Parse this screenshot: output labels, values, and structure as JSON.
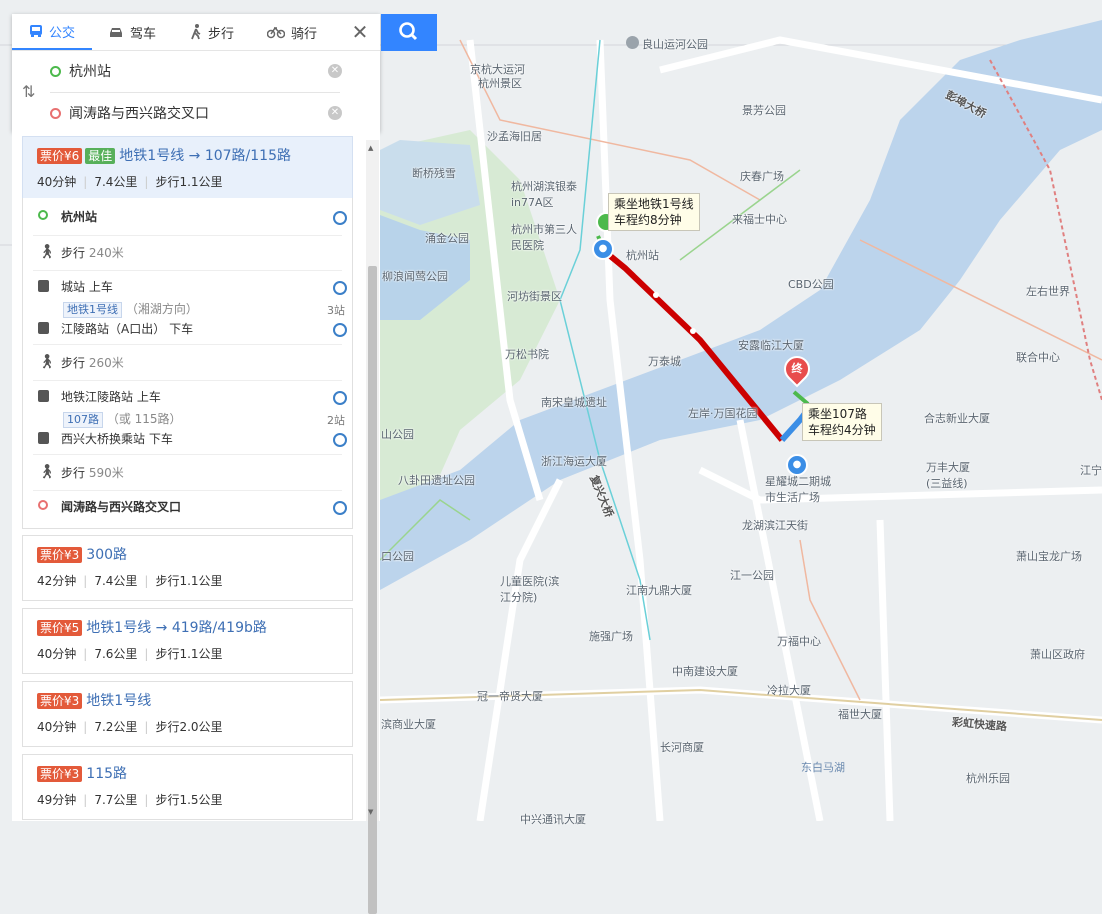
{
  "search": {
    "modes": [
      {
        "label": "公交",
        "icon": "bus-icon",
        "active": true
      },
      {
        "label": "驾车",
        "icon": "car-icon",
        "active": false
      },
      {
        "label": "步行",
        "icon": "walk-icon",
        "active": false
      },
      {
        "label": "骑行",
        "icon": "bike-icon",
        "active": false
      }
    ],
    "origin": "杭州站",
    "destination": "闻涛路与西兴路交叉口"
  },
  "routes": [
    {
      "price": "票价¥6",
      "best": "最佳",
      "name": "地铁1号线 → 107路/115路",
      "time": "40分钟",
      "distance": "7.4公里",
      "walk": "步行1.1公里",
      "steps": [
        {
          "type": "start",
          "text": "杭州站"
        },
        {
          "type": "walk",
          "text": "步行",
          "dist": "240米"
        },
        {
          "type": "board",
          "station": "城站",
          "action": "上车",
          "line": "地铁1号线",
          "direction": "（湘湖方向）",
          "stops": "3站",
          "alight_station": "江陵路站",
          "alight_detail": "（A口出）",
          "alight_action": "下车"
        },
        {
          "type": "walk",
          "text": "步行",
          "dist": "260米"
        },
        {
          "type": "board",
          "station": "地铁江陵路站",
          "action": "上车",
          "line": "107路",
          "direction": "（或 115路）",
          "stops": "2站",
          "alight_station": "西兴大桥换乘站",
          "alight_detail": "",
          "alight_action": "下车"
        },
        {
          "type": "walk",
          "text": "步行",
          "dist": "590米"
        },
        {
          "type": "end",
          "text": "闻涛路与西兴路交叉口"
        }
      ]
    },
    {
      "price": "票价¥3",
      "name": "300路",
      "time": "42分钟",
      "distance": "7.4公里",
      "walk": "步行1.1公里"
    },
    {
      "price": "票价¥5",
      "name": "地铁1号线 → 419路/419b路",
      "time": "40分钟",
      "distance": "7.6公里",
      "walk": "步行1.1公里"
    },
    {
      "price": "票价¥3",
      "name": "地铁1号线",
      "time": "40分钟",
      "distance": "7.2公里",
      "walk": "步行2.0公里"
    },
    {
      "price": "票价¥3",
      "name": "115路",
      "time": "49分钟",
      "distance": "7.7公里",
      "walk": "步行1.5公里"
    }
  ],
  "map": {
    "callout_metro": [
      "乘坐地铁1号线",
      "车程约8分钟"
    ],
    "callout_bus": [
      "乘坐107路",
      "车程约4分钟"
    ],
    "end_label": "终",
    "labels": {
      "l1": "良山运河公园",
      "l2": "京杭大运河",
      "l3": "杭州景区",
      "l4": "景芳公园",
      "l5": "沙孟海旧居",
      "l6": "断桥残雪",
      "l7": "杭州湖滨银泰in77A区",
      "l8": "庆春广场",
      "l9": "杭州市第三人民医院",
      "l10": "来福士中心",
      "l11": "杭州站",
      "l12": "涌金公园",
      "l13": "柳浪闻莺公园",
      "l14": "河坊街景区",
      "l15": "CBD公园",
      "l16": "左右世界",
      "l17": "万松书院",
      "l18": "万泰城",
      "l19": "安露临江大厦",
      "l20": "联合中心",
      "l21": "南宋皇城遗址",
      "l22": "左岸·万国花园",
      "l23": "合志新业大厦",
      "l24": "浙江海运大厦",
      "l25": "八卦田遗址公园",
      "l26": "星耀城二期城市生活广场",
      "l27": "万丰大厦(三益线)",
      "l28": "龙湖滨江天街",
      "l29": "萧山宝龙广场",
      "l30": "儿童医院(滨江分院)",
      "l31": "江南九鼎大厦",
      "l32": "江一公园",
      "l33": "施强广场",
      "l34": "万福中心",
      "l35": "萧山区政府",
      "l36": "中南建设大厦",
      "l37": "冠一帝贤大厦",
      "l38": "冷拉大厦",
      "l39": "福世大厦",
      "l40": "滨商业大厦",
      "l41": "长河商厦",
      "l42": "东白马湖",
      "l43": "杭州乐园",
      "l44": "中兴通讯大厦",
      "l45": "江山公园",
      "l46": "山公园",
      "l47": "口公园",
      "road1": "彭埠大桥",
      "road2": "复兴大桥",
      "road3": "彩虹快速路",
      "road4": "江宁"
    }
  }
}
